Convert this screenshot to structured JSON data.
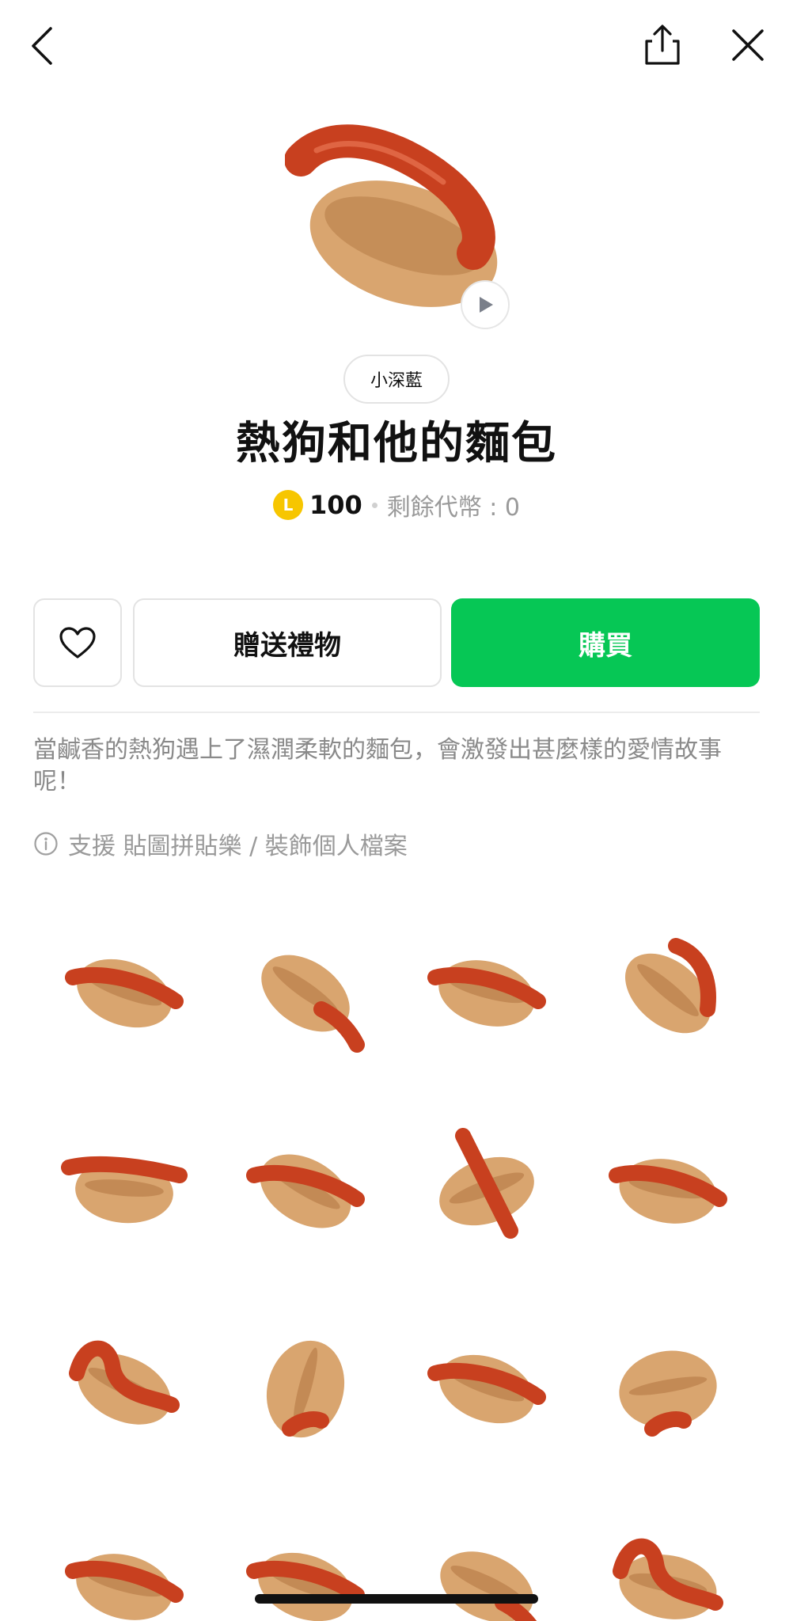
{
  "nav": {
    "back_icon": "chevron-left-icon",
    "share_icon": "share-icon",
    "close_icon": "close-icon"
  },
  "product": {
    "author": "小深藍",
    "title": "熱狗和他的麵包",
    "coin_symbol": "L",
    "price": "100",
    "balance_text": "剩餘代幣 : 0",
    "description": "當鹹香的熱狗遇上了濕潤柔軟的麵包，會激發出甚麼樣的愛情故事呢！",
    "support_text": "支援 貼圖拼貼樂 / 裝飾個人檔案"
  },
  "actions": {
    "favorite_icon": "heart-outline-icon",
    "gift_label": "贈送禮物",
    "buy_label": "購買"
  },
  "colors": {
    "buy_green": "#06c755",
    "coin_yellow": "#f7c600",
    "sausage": "#c8401f",
    "bun": "#d9a56f"
  },
  "stickers": [
    {
      "name": "hotdog-sticker-1"
    },
    {
      "name": "hotdog-sticker-2"
    },
    {
      "name": "hotdog-sticker-3"
    },
    {
      "name": "hotdog-sticker-4"
    },
    {
      "name": "hotdog-sticker-5"
    },
    {
      "name": "hotdog-sticker-6"
    },
    {
      "name": "hotdog-sticker-7"
    },
    {
      "name": "hotdog-sticker-8"
    },
    {
      "name": "hotdog-sticker-9"
    },
    {
      "name": "hotdog-sticker-10"
    },
    {
      "name": "hotdog-sticker-11"
    },
    {
      "name": "hotdog-sticker-12"
    },
    {
      "name": "hotdog-sticker-13"
    },
    {
      "name": "hotdog-sticker-14"
    },
    {
      "name": "hotdog-sticker-15"
    },
    {
      "name": "hotdog-sticker-16"
    }
  ]
}
